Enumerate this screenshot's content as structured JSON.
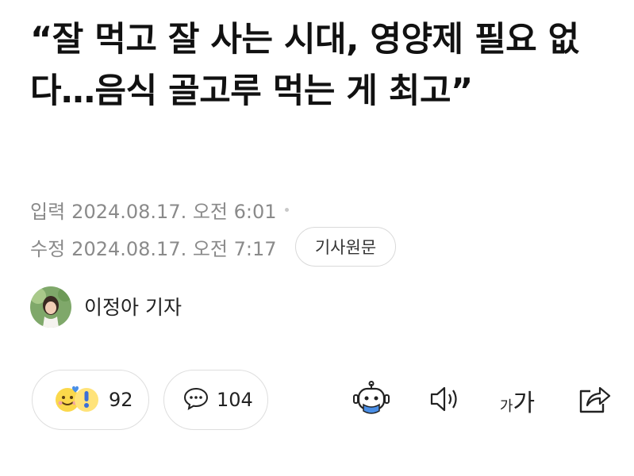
{
  "article": {
    "headline": "“잘 먹고 잘 사는 시대, 영양제 필요 없다…음식 골고루 먹는 게 최고”",
    "published_label": "입력",
    "published_value": "2024.08.17. 오전 6:01",
    "modified_label": "수정",
    "modified_value": "2024.08.17. 오전 7:17",
    "original_button": "기사원문"
  },
  "reporter": {
    "name": "이정아 기자"
  },
  "actions": {
    "reaction_count": "92",
    "comment_count": "104",
    "font_size_small": "가",
    "font_size_large": "가"
  },
  "colors": {
    "text": "#111111",
    "meta": "#8a8a8a",
    "border": "#dedede"
  }
}
